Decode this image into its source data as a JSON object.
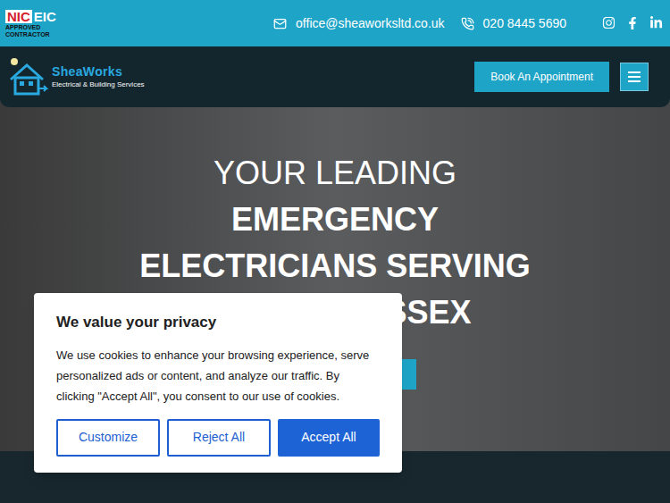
{
  "top_bar": {
    "badge": {
      "mark": [
        "NIC",
        "EIC"
      ],
      "caption": [
        "APPROVED",
        "CONTRACTOR"
      ]
    },
    "email": "office@sheaworksltd.co.uk",
    "phone": "020 8445 5690"
  },
  "nav": {
    "brand": "SheaWorks",
    "tagline": "Electrical & Building Services",
    "cta": "Book An Appointment"
  },
  "hero": {
    "lines": [
      {
        "text": "YOUR LEADING",
        "kind": "light"
      },
      {
        "text": "EMERGENCY",
        "kind": "bold"
      },
      {
        "text": "ELECTRICIANS SERVING",
        "kind": "bold"
      },
      {
        "text": "ESSEX",
        "kind": "partial"
      }
    ]
  },
  "cookie_dialog": {
    "title": "We value your privacy",
    "body": "We use cookies to enhance your browsing experience, serve personalized ads or content, and analyze our traffic. By clicking \"Accept All\", you consent to our use of cookies.",
    "buttons": [
      {
        "label": "Customize",
        "kind": "outline"
      },
      {
        "label": "Reject All",
        "kind": "outline"
      },
      {
        "label": "Accept All",
        "kind": "primary"
      }
    ]
  }
}
